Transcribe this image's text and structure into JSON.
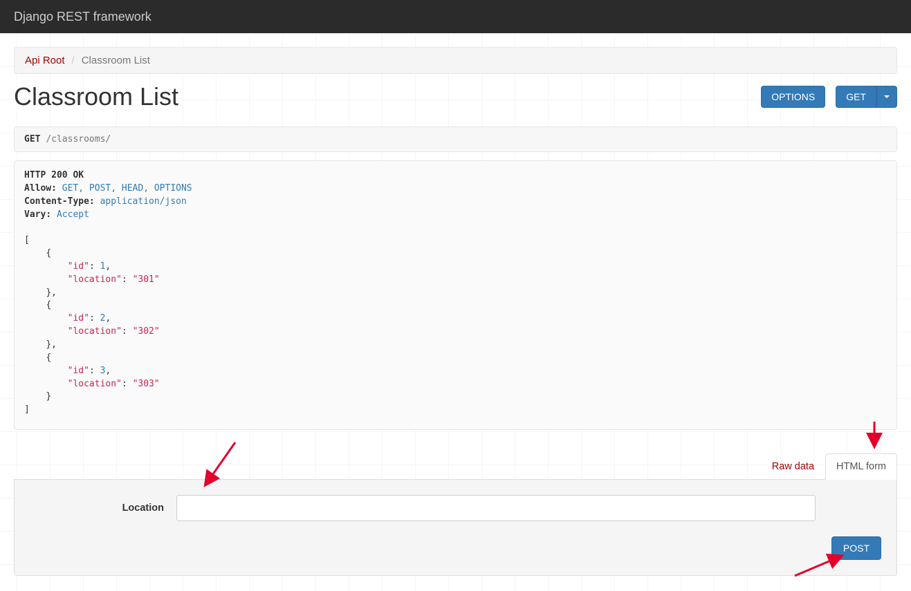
{
  "brand": "Django REST framework",
  "breadcrumb": {
    "root": "Api Root",
    "current": "Classroom List"
  },
  "page_title": "Classroom List",
  "buttons": {
    "options": "OPTIONS",
    "get": "GET",
    "post": "POST"
  },
  "request": {
    "method": "GET",
    "path": "/classrooms/"
  },
  "response": {
    "status_line": "HTTP 200 OK",
    "headers": [
      {
        "k": "Allow:",
        "v": "GET, POST, HEAD, OPTIONS"
      },
      {
        "k": "Content-Type:",
        "v": "application/json"
      },
      {
        "k": "Vary:",
        "v": "Accept"
      }
    ],
    "items": [
      {
        "id": 1,
        "location": "301"
      },
      {
        "id": 2,
        "location": "302"
      },
      {
        "id": 3,
        "location": "303"
      }
    ]
  },
  "tabs": {
    "raw": "Raw data",
    "html": "HTML form"
  },
  "form": {
    "location_label": "Location",
    "location_value": ""
  }
}
